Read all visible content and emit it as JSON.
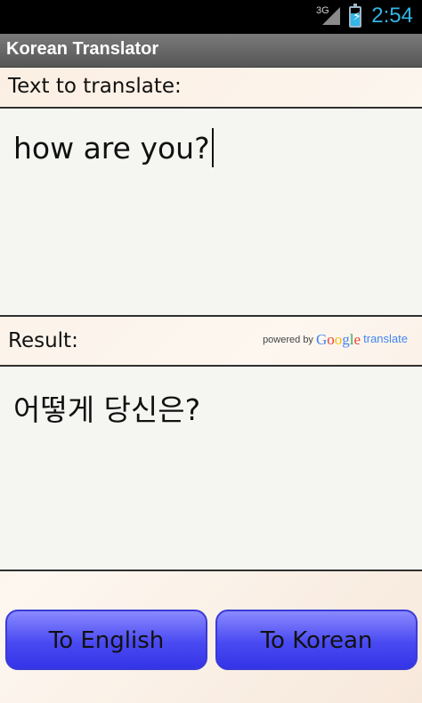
{
  "status_bar": {
    "network": "3G",
    "time": "2:54"
  },
  "app": {
    "title": "Korean Translator"
  },
  "input": {
    "label": "Text to translate:",
    "value": "how are you?"
  },
  "result": {
    "label": "Result:",
    "powered_by": "powered by",
    "google": "Google",
    "translate": "translate",
    "value": "어떻게 당신은?"
  },
  "buttons": {
    "to_english": "To English",
    "to_korean": "To Korean"
  },
  "colors": {
    "clock": "#33b5e5",
    "button": "#4a4af2",
    "title_bar": "#666666"
  }
}
